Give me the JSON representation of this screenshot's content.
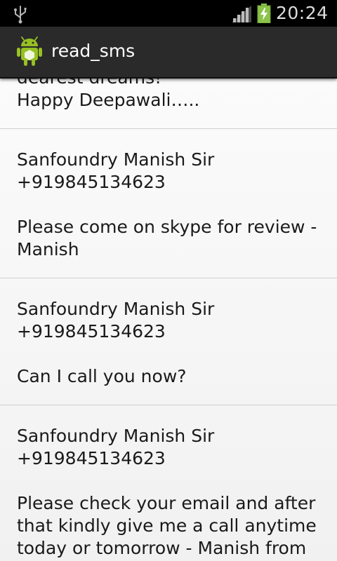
{
  "status_bar": {
    "time": "20:24",
    "icons": [
      "usb-icon",
      "signal-icon",
      "battery-charging-icon"
    ]
  },
  "action_bar": {
    "title": "read_sms",
    "icon": "android-icon"
  },
  "messages": [
    {
      "text": "dearest dreams!\nHappy Deepawali….."
    },
    {
      "text": "Sanfoundry Manish Sir\n+919845134623\n\nPlease come on skype for review - Manish"
    },
    {
      "text": "Sanfoundry Manish Sir\n+919845134623\n\nCan I call you now?"
    },
    {
      "text": "Sanfoundry Manish Sir\n+919845134623\n\nPlease check your email and after that kindly give me a call anytime today or tomorrow - Manish from"
    }
  ],
  "colors": {
    "status_bar": "#000000",
    "action_bar": "#2a2a2a",
    "list_background": "#f5f5f5",
    "divider": "#cfcfcf",
    "battery_green": "#8bc34a"
  }
}
